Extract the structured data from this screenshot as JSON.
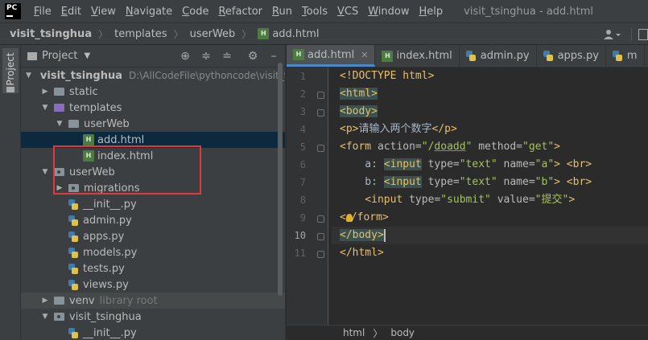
{
  "window": {
    "title": "visit_tsinghua - add.html",
    "logo": "PC"
  },
  "menu": [
    {
      "label": "File",
      "mnemonic": "F",
      "rest": "ile"
    },
    {
      "label": "Edit",
      "mnemonic": "E",
      "rest": "dit"
    },
    {
      "label": "View",
      "mnemonic": "V",
      "rest": "iew"
    },
    {
      "label": "Navigate",
      "mnemonic": "N",
      "rest": "avigate"
    },
    {
      "label": "Code",
      "mnemonic": "C",
      "rest": "ode"
    },
    {
      "label": "Refactor",
      "mnemonic": "R",
      "rest": "efactor"
    },
    {
      "label": "Run",
      "mnemonic": "R",
      "rest": "un"
    },
    {
      "label": "Tools",
      "mnemonic": "T",
      "rest": "ools"
    },
    {
      "label": "VCS",
      "mnemonic": "V",
      "rest": "CS"
    },
    {
      "label": "Window",
      "mnemonic": "W",
      "rest": "indow"
    },
    {
      "label": "Help",
      "mnemonic": "H",
      "rest": "elp"
    }
  ],
  "breadcrumb": {
    "project": "visit_tsinghua",
    "folder1": "templates",
    "folder2": "userWeb",
    "file": "add.html",
    "file_icon": "H"
  },
  "tool_strip": {
    "project_label": "Project"
  },
  "project_panel": {
    "title": "Project",
    "tree": {
      "root": {
        "label": "visit_tsinghua",
        "path": "D:\\AllCodeFile\\pythoncode\\visit_ts"
      },
      "static": "static",
      "templates": "templates",
      "userWeb_tpl": "userWeb",
      "add_html": "add.html",
      "index_html": "index.html",
      "userWeb_app": "userWeb",
      "migrations": "migrations",
      "init_py": "__init__.py",
      "admin_py": "admin.py",
      "apps_py": "apps.py",
      "models_py": "models.py",
      "tests_py": "tests.py",
      "views_py": "views.py",
      "venv": "venv",
      "venv_hint": "library root",
      "visit_pkg": "visit_tsinghua",
      "init_py2": "__init__.py"
    }
  },
  "editor": {
    "tabs": [
      {
        "label": "add.html",
        "active": true
      },
      {
        "label": "index.html"
      },
      {
        "label": "admin.py"
      },
      {
        "label": "apps.py"
      },
      {
        "label": "m"
      }
    ],
    "line_numbers": [
      "1",
      "2",
      "3",
      "4",
      "5",
      "6",
      "7",
      "8",
      "9",
      "10",
      "11"
    ],
    "current_line": "10",
    "code": {
      "l1": "<!DOCTYPE html>",
      "l2": "<html>",
      "l3": "<body>",
      "l4_open": "<p>",
      "l4_text": "请输入两个数字",
      "l4_close": "</p>",
      "l5_tag": "<form",
      "l5_attr1": " action=",
      "l5_val1a": "\"/",
      "l5_val1b": "doadd",
      "l5_val1c": "\"",
      "l5_attr2": " method=",
      "l5_val2": "\"get\"",
      "l5_end": ">",
      "l6_text": "    a: ",
      "l6_tag": "<input",
      "l6_attr1": " type=",
      "l6_val1": "\"text\"",
      "l6_attr2": " name=",
      "l6_val2": "\"a\"",
      "l6_end": ">",
      "l6_br": " <br>",
      "l7_text": "    b: ",
      "l7_tag": "<input",
      "l7_attr1": " type=",
      "l7_val1": "\"text\"",
      "l7_attr2": " name=",
      "l7_val2": "\"b\"",
      "l7_end": ">",
      "l7_br": " <br>",
      "l8_tag": "    <input",
      "l8_attr1": " type=",
      "l8_val1": "\"submit\"",
      "l8_attr2": " value=",
      "l8_val2": "\"提交\"",
      "l8_end": ">",
      "l9_a": "<",
      "l9_b": "/form>",
      "l10": "</body>",
      "l11": "</html>"
    },
    "bottom_breadcrumb": [
      "html",
      "body"
    ]
  },
  "colors": {
    "accent": "#4a88c7",
    "selection": "#0d293e",
    "highlight_box": "#e0393e",
    "tag": "#e8bf6a",
    "attr_value": "#a5c25c"
  },
  "icons": [
    "pycharm-logo-icon",
    "user-icon",
    "folder-icon",
    "gear-icon",
    "target-icon",
    "collapse-icon",
    "expand-icon",
    "minimize-icon",
    "html-file-icon",
    "python-file-icon",
    "lightbulb-icon"
  ]
}
